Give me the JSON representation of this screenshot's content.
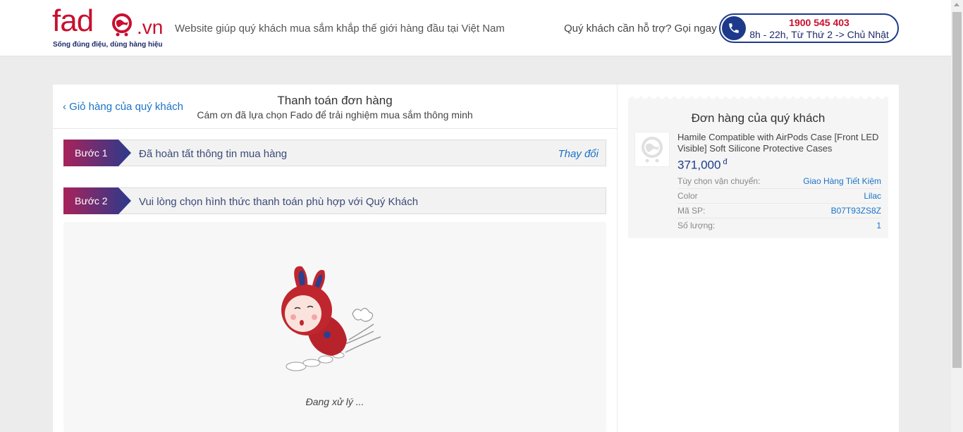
{
  "header": {
    "logo_text": "fado",
    "logo_suffix": ".vn",
    "logo_tagline": "Sống đúng điệu, dùng hàng hiệu",
    "tagline": "Website giúp quý khách mua sắm khắp thế giới hàng đầu tại Việt Nam",
    "support_prompt": "Quý khách cần hỗ trợ? Gọi ngay",
    "hotline_number": "1900 545 403",
    "hotline_hours": "8h - 22h, Từ Thứ 2 -> Chủ Nhật",
    "icon": "phone-icon"
  },
  "checkout": {
    "back_link": "Giỏ hàng của quý khách",
    "title": "Thanh toán đơn hàng",
    "subtitle": "Cám ơn đã lựa chọn Fado để trải nghiệm mua sắm thông minh",
    "steps": [
      {
        "label": "Bước 1",
        "text": "Đã hoàn tất thông tin mua hàng",
        "action": "Thay đổi"
      },
      {
        "label": "Bước 2",
        "text": "Vui lòng chọn hình thức thanh toán phù hợp với Quý Khách"
      }
    ],
    "processing_text": "Đang xử lý ..."
  },
  "order": {
    "title": "Đơn hàng của quý khách",
    "product_name": "Hamile Compatible with AirPods Case [Front LED Visible] Soft Silicone Protective Cases",
    "price": "371,000",
    "currency": "đ",
    "details": [
      {
        "key": "Tùy chọn vận chuyển:",
        "value": "Giao Hàng Tiết Kiệm"
      },
      {
        "key": "Color",
        "value": "Lilac"
      },
      {
        "key": "Mã SP:",
        "value": "B07T93ZS8Z"
      },
      {
        "key": "Số lượng:",
        "value": "1"
      }
    ]
  },
  "colors": {
    "brand_red": "#c8102e",
    "brand_blue": "#1d3a8a",
    "link_blue": "#1a73c8"
  }
}
